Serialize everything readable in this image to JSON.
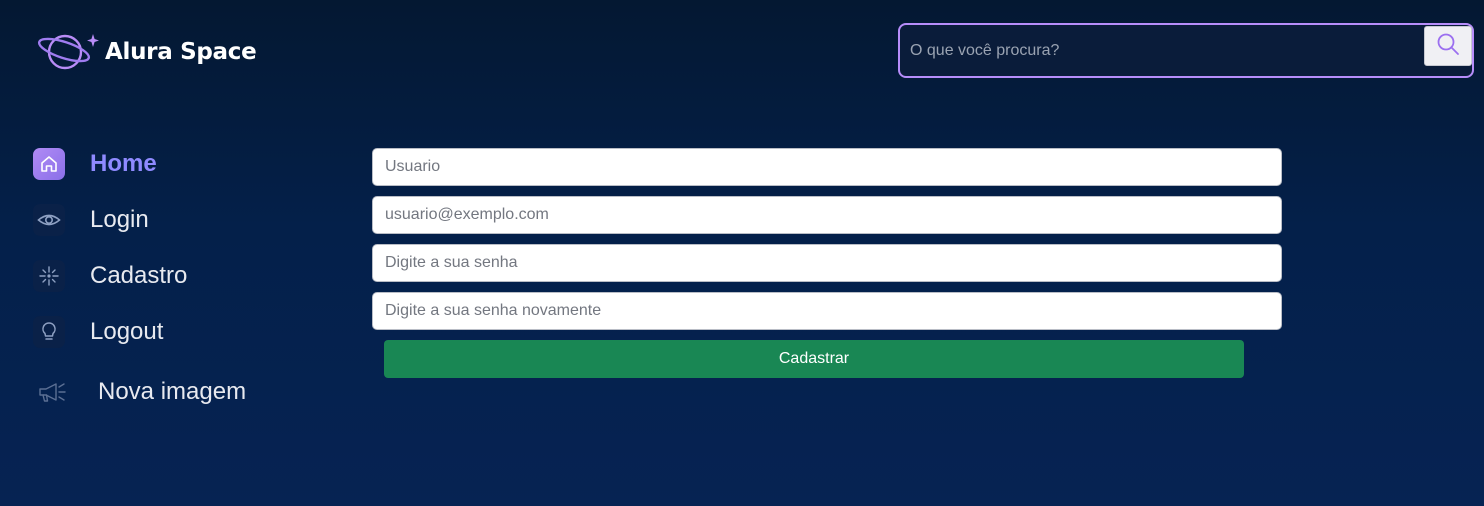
{
  "header": {
    "logo_text": "Alura Space",
    "logo_icon": "planet-icon",
    "search": {
      "placeholder": "O que você procura?",
      "value": "",
      "button_icon": "search-icon"
    }
  },
  "sidebar": {
    "items": [
      {
        "label": "Home",
        "icon": "home-icon",
        "active": true
      },
      {
        "label": "Login",
        "icon": "eye-icon",
        "active": false
      },
      {
        "label": "Cadastro",
        "icon": "sparkle-icon",
        "active": false
      },
      {
        "label": "Logout",
        "icon": "lightbulb-icon",
        "active": false
      },
      {
        "label": "Nova imagem",
        "icon": "megaphone-icon",
        "active": false
      }
    ]
  },
  "form": {
    "username_placeholder": "Usuario",
    "email_placeholder": "usuario@exemplo.com",
    "password_placeholder": "Digite a sua senha",
    "password_confirm_placeholder": "Digite a sua senha novamente",
    "submit_label": "Cadastrar"
  },
  "colors": {
    "background": "#041832",
    "accent": "#b78dfa",
    "active_nav": "#8f8aff",
    "submit": "#198754"
  }
}
